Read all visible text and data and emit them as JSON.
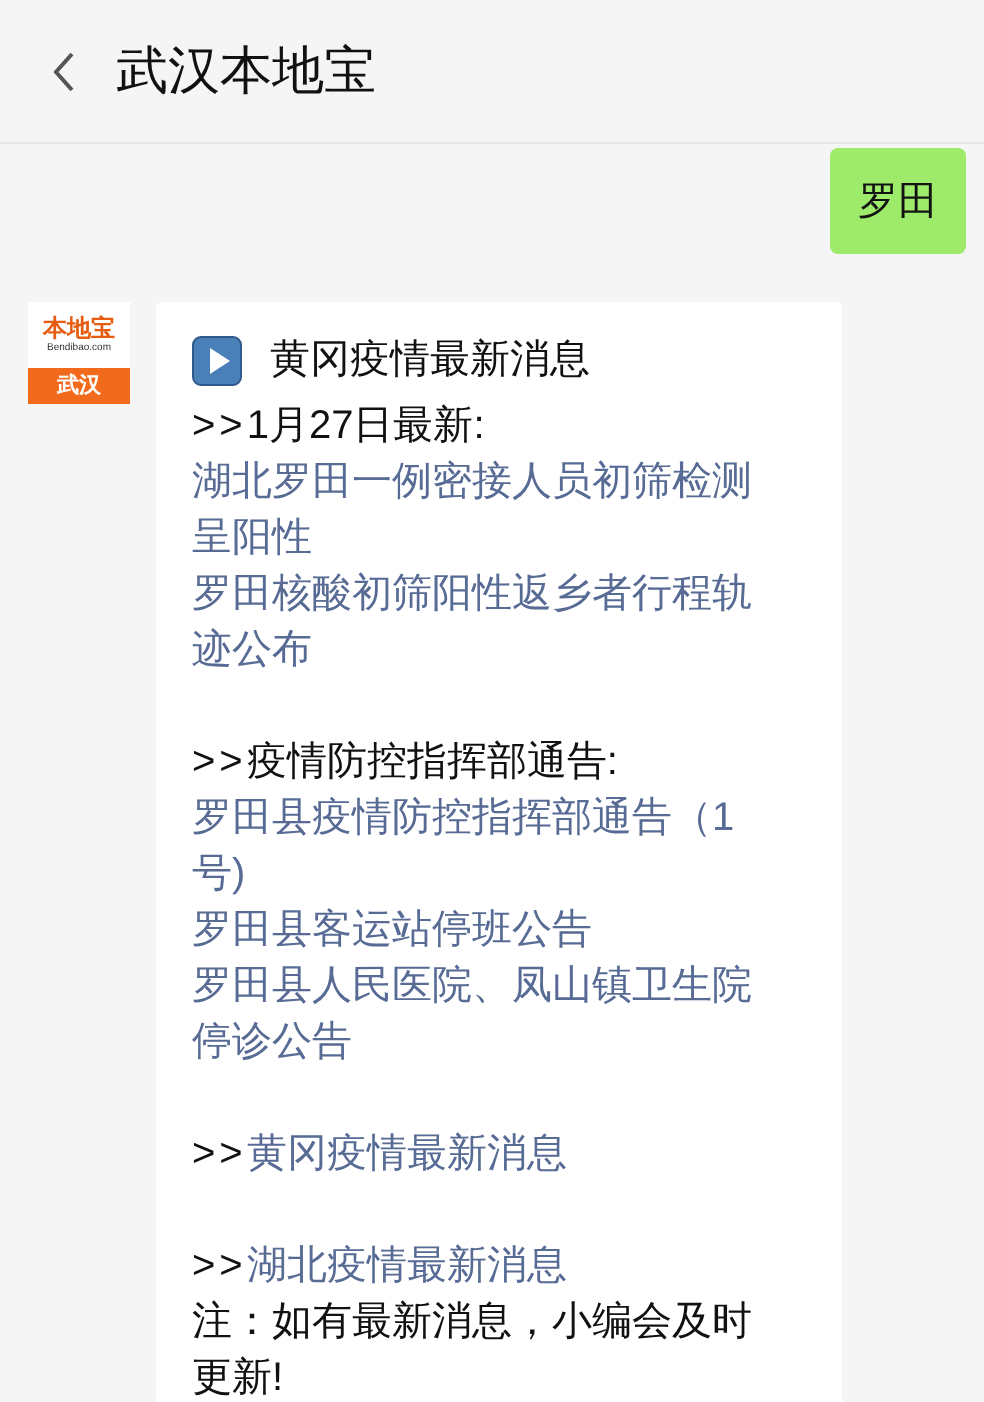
{
  "header": {
    "title": "武汉本地宝"
  },
  "messages": [
    {
      "kind": "outgoing",
      "text": "罗田"
    },
    {
      "kind": "incoming",
      "avatar": {
        "logo_text": "本地宝",
        "site": "Bendibao.com",
        "city": "武汉"
      },
      "title": "黄冈疫情最新消息",
      "lines": [
        {
          "kind": "heading",
          "prefix": ">>",
          "text": "1月27日最新:"
        },
        {
          "kind": "link",
          "text": "湖北罗田一例密接人员初筛检测呈阳性"
        },
        {
          "kind": "link",
          "text": "罗田核酸初筛阳性返乡者行程轨迹公布"
        },
        {
          "kind": "section_heading",
          "prefix": ">>",
          "text": "疫情防控指挥部通告:"
        },
        {
          "kind": "link",
          "text": "罗田县疫情防控指挥部通告（1号)"
        },
        {
          "kind": "link",
          "text": "罗田县客运站停班公告"
        },
        {
          "kind": "link",
          "text": "罗田县人民医院、凤山镇卫生院停诊公告"
        },
        {
          "kind": "section_link",
          "prefix": ">>",
          "text": "黄冈疫情最新消息"
        },
        {
          "kind": "section_link",
          "prefix": ">>",
          "text": "湖北疫情最新消息"
        },
        {
          "kind": "text",
          "text": "注：如有最新消息，小编会及时更新!"
        }
      ]
    }
  ]
}
